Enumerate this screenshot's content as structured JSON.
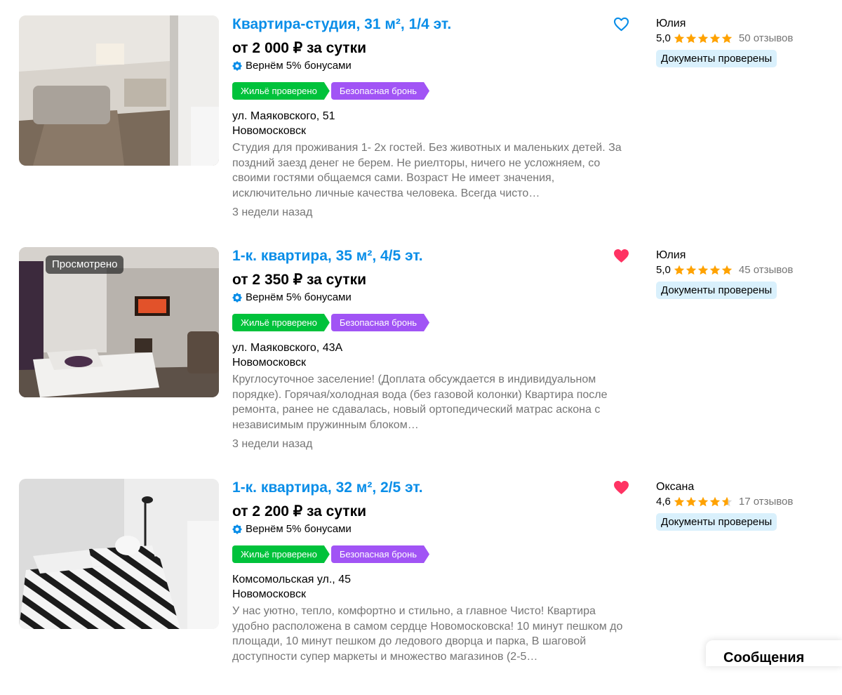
{
  "listings": [
    {
      "title": "Квартира-студия, 31 м², 1/4 эт.",
      "price": "от 2 000 ₽ за сутки",
      "bonus": "Вернём 5% бонусами",
      "badge_verified": "Жильё проверено",
      "badge_safe": "Безопасная бронь",
      "street": "ул. Маяковского, 51",
      "city": "Новомосковск",
      "description": "Студия для проживания 1- 2х гостей. Без животных и маленьких детей. За поздний заезд денег не берем. Не риелторы, ничего не усложняем, со своими гостями общаемся сами. Возраст Не имеет значения, исключительно личные качества человека. Всегда чисто…",
      "date": "3 недели назад",
      "favorited": false,
      "seller": "Юлия",
      "rating": "5,0",
      "stars": 5.0,
      "reviews": "50 отзывов",
      "docs": "Документы проверены"
    },
    {
      "viewed": "Просмотрено",
      "title": "1-к. квартира, 35 м², 4/5 эт.",
      "price": "от 2 350 ₽ за сутки",
      "bonus": "Вернём 5% бонусами",
      "badge_verified": "Жильё проверено",
      "badge_safe": "Безопасная бронь",
      "street": "ул. Маяковского, 43А",
      "city": "Новомосковск",
      "description": "Круглосуточное заселение! (Доплата обсуждается в индивидуальном порядке). Горячая/холодная вода (без газовой колонки) Квартира после ремонта, ранее не сдавалась, новый ортопедический матрас аскона с независимым пружинным блоком…",
      "date": "3 недели назад",
      "favorited": true,
      "seller": "Юлия",
      "rating": "5,0",
      "stars": 5.0,
      "reviews": "45 отзывов",
      "docs": "Документы проверены"
    },
    {
      "title": "1-к. квартира, 32 м², 2/5 эт.",
      "price": "от 2 200 ₽ за сутки",
      "bonus": "Вернём 5% бонусами",
      "badge_verified": "Жильё проверено",
      "badge_safe": "Безопасная бронь",
      "street": "Комсомольская ул., 45",
      "city": "Новомосковск",
      "description": "У нас уютно, тепло, комфортно и стильно, а главное Чисто! Квартира удобно расположена в самом сердце Новомосковска! 10 минут пешком до площади, 10 минут пешком до ледового дворца и парка, В шаговой доступности супер маркеты и множество магазинов (2-5…",
      "date": "",
      "favorited": true,
      "seller": "Оксана",
      "rating": "4,6",
      "stars": 4.6,
      "reviews": "17 отзывов",
      "docs": "Документы проверены"
    }
  ],
  "colors": {
    "title": "#0a8ee8",
    "star": "#ffa200",
    "heart_active": "#ff3363",
    "heart_outline": "#0a8ee8",
    "badge_green": "#00c23b",
    "badge_purple": "#a154f5",
    "docs_bg": "#d9f0fc"
  },
  "messages_label": "Сообщения"
}
